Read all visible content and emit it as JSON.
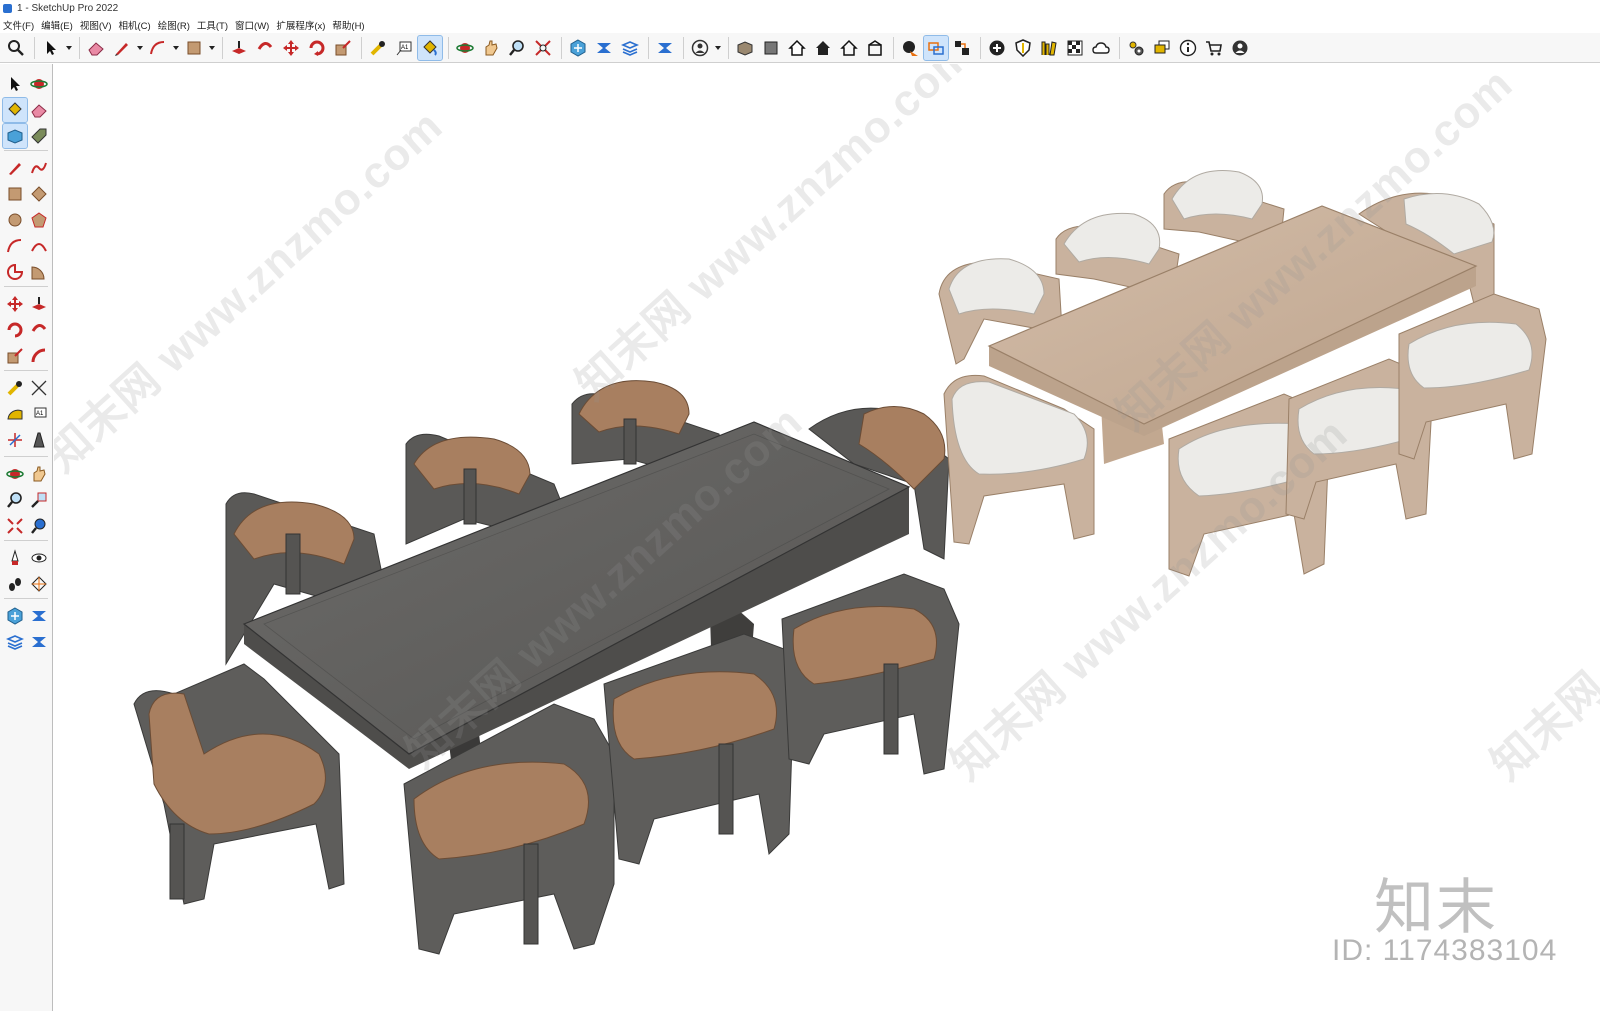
{
  "window": {
    "title": "1 - SketchUp Pro 2022"
  },
  "menu": [
    "文件(F)",
    "编辑(E)",
    "视图(V)",
    "相机(C)",
    "绘图(R)",
    "工具(T)",
    "窗口(W)",
    "扩展程序(x)",
    "帮助(H)"
  ],
  "watermarks": {
    "site": "知末网 www.znzmo.com",
    "brand": "知末",
    "asset_id": "ID: 1174383104"
  },
  "colors": {
    "dark_wood": "#5f5e5c",
    "leather": "#a87f60",
    "light_wood": "#c9b29e",
    "cushion": "#ececea",
    "accent": "#cfe4fb"
  },
  "toolbar_icons": [
    "search-icon",
    "select-icon",
    "eraser-icon",
    "pencil-icon",
    "arc-icon",
    "rectangle-icon",
    "push-pull-icon",
    "follow-me-icon",
    "move-icon",
    "rotate-icon",
    "scale-icon",
    "tape-measure-icon",
    "text-icon",
    "paint-bucket-icon",
    "orbit-icon",
    "pan-icon",
    "zoom-icon",
    "zoom-extents-icon",
    "warehouse-icon",
    "extension-warehouse-icon",
    "layout-icon",
    "user-icon",
    "component-icon",
    "solid-icon",
    "house-icon",
    "house-side-icon",
    "house-outline-icon",
    "house-back-icon",
    "section-plane-icon",
    "section-fill-icon",
    "display-section-icon",
    "add-icon",
    "shield-icon",
    "library-icon",
    "texture-icon",
    "cloud-icon",
    "settings-icon",
    "chat-icon",
    "info-icon",
    "cart-icon",
    "account-icon"
  ],
  "sidebar_icons": [
    "select-icon",
    "orbit-icon",
    "paint-bucket-icon",
    "eraser-icon",
    "component-icon",
    "tag-icon",
    "pencil-icon",
    "freehand-icon",
    "rectangle-icon",
    "rotated-rectangle-icon",
    "circle-icon",
    "polygon-icon",
    "arc-icon",
    "two-point-arc-icon",
    "pie-icon",
    "sector-icon",
    "move-icon",
    "push-pull-icon",
    "rotate-icon",
    "follow-me-icon",
    "scale-icon",
    "offset-icon",
    "tape-measure-icon",
    "dimension-icon",
    "protractor-icon",
    "text-icon",
    "axes-icon",
    "3d-text-icon",
    "orbit-icon",
    "pan-icon",
    "zoom-icon",
    "zoom-window-icon",
    "zoom-extents-icon",
    "previous-view-icon",
    "position-camera-icon",
    "look-around-icon",
    "walk-icon",
    "section-plane-icon",
    "warehouse-icon",
    "extension-icon",
    "layout-icon",
    "send-icon"
  ]
}
